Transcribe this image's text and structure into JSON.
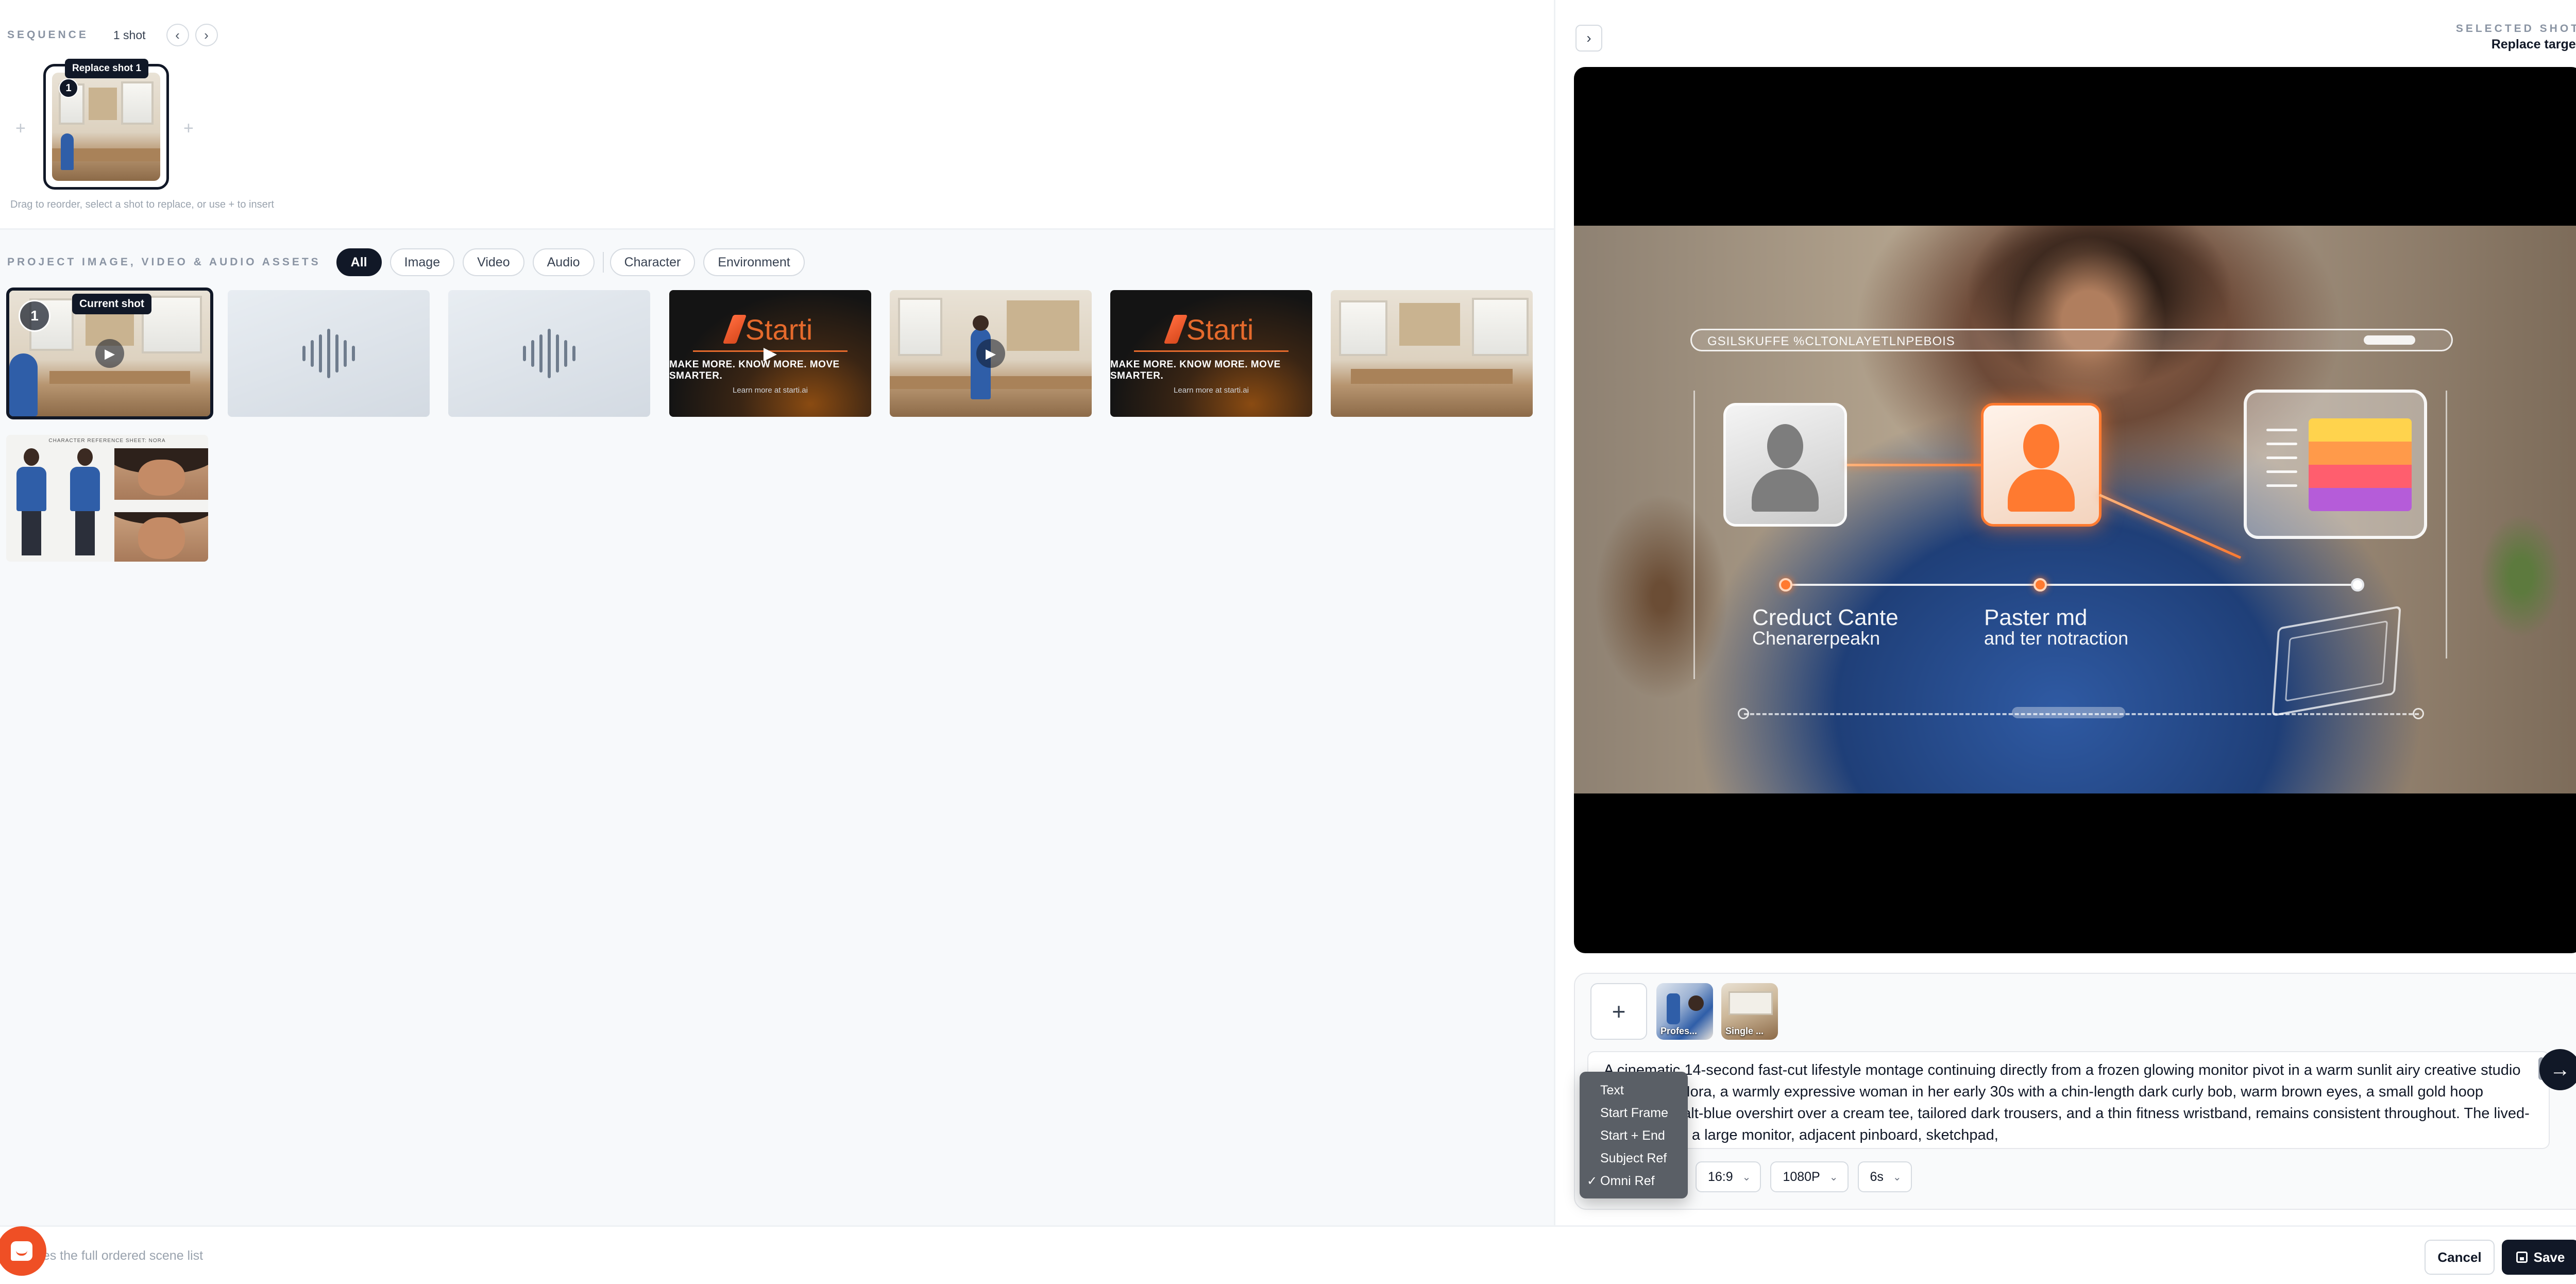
{
  "sequence": {
    "label": "SEQUENCE",
    "count": "1 shot",
    "prev_icon": "chevron-left-icon",
    "next_icon": "chevron-right-icon",
    "add_glyph": "+",
    "shot_number": "1",
    "replace_tooltip": "Replace shot 1",
    "hint": "Drag to reorder, select a shot to replace, or use + to insert"
  },
  "assets": {
    "label": "PROJECT IMAGE, VIDEO & AUDIO ASSETS",
    "filters": [
      "All",
      "Image",
      "Video",
      "Audio",
      "Character",
      "Environment"
    ],
    "active_filter": "All",
    "current_badge": "1",
    "current_tooltip": "Current shot",
    "brand": {
      "logo": "Starti",
      "tagline": "MAKE MORE. KNOW MORE. MOVE SMARTER.",
      "url_line": "Learn more at starti.ai"
    },
    "character_sheet_title": "CHARACTER REFERENCE SHEET: NORA"
  },
  "panel": {
    "collapse_icon": "chevron-right-icon",
    "selected_label": "SELECTED SHOT",
    "selected_target": "Replace target"
  },
  "preview": {
    "bar_text": "GSILSKUFFE %CLTONLAYETLNPEBOIS",
    "label1_line1": "Creduct Cante",
    "label1_line2": "Chenarerpeakn",
    "label2_line1": "Paster md",
    "label2_line2": "and ter notraction"
  },
  "composer": {
    "add_glyph": "+",
    "refs": [
      {
        "label": "Profes..."
      },
      {
        "label": "Single ..."
      }
    ],
    "prompt": "A cinematic 14-second fast-cut lifestyle montage continuing directly from a frozen glowing monitor pivot in a warm sunlit airy creative studio in daylight. Nora, a warmly expressive woman in her early 30s with a chin-length dark curly bob, warm brown eyes, a small gold hoop earring, cobalt-blue overshirt over a cream tee, tailored dark trousers, and a thin fitness wristband, remains consistent throughout. The lived-in studio has a large monitor, adjacent pinboard, sketchpad,",
    "send_icon": "arrow-right-icon",
    "options": {
      "aspect": "16:9",
      "resolution": "1080P",
      "duration": "6s"
    },
    "mode_menu": {
      "items": [
        "Text",
        "Start Frame",
        "Start + End",
        "Subject Ref",
        "Omni Ref"
      ],
      "selected": "Omni Ref",
      "check_glyph": "✓"
    }
  },
  "footer": {
    "hint": "rites the full ordered scene list",
    "cancel": "Cancel",
    "save": "Save"
  }
}
